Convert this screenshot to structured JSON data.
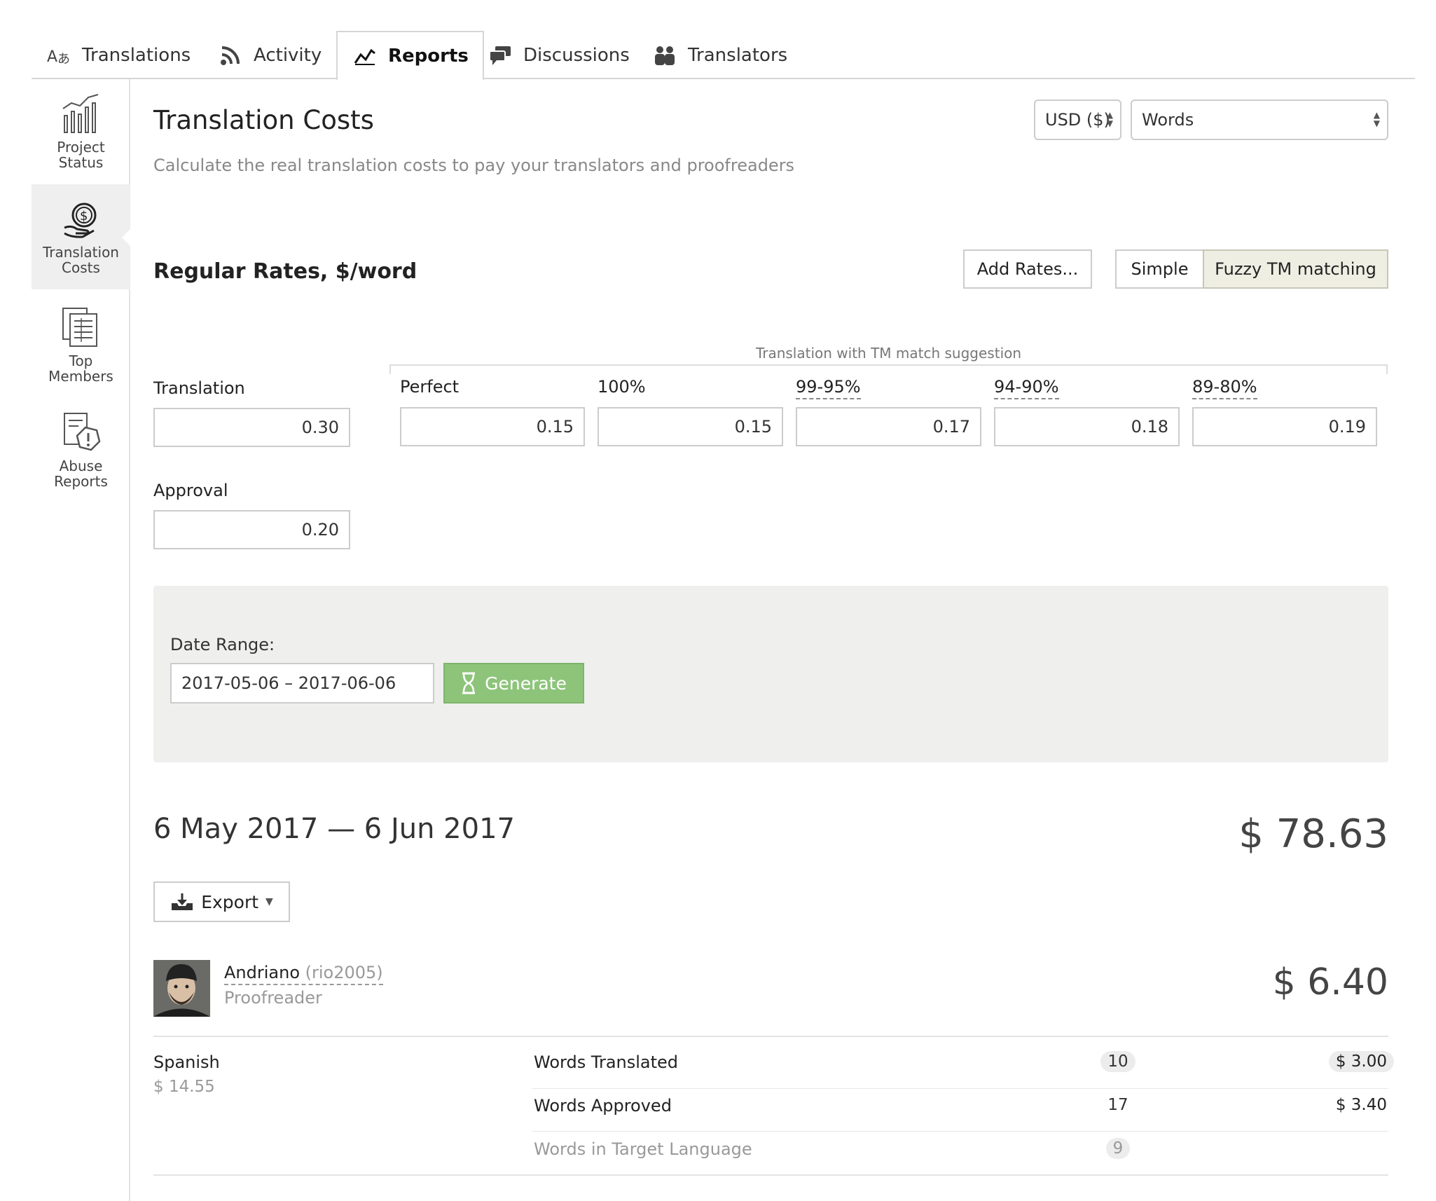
{
  "tabs": [
    {
      "label": "Translations",
      "icon": "translate-icon"
    },
    {
      "label": "Activity",
      "icon": "rss-icon"
    },
    {
      "label": "Reports",
      "icon": "chart-line-icon",
      "active": true
    },
    {
      "label": "Discussions",
      "icon": "chat-bubbles-icon"
    },
    {
      "label": "Translators",
      "icon": "people-icon"
    }
  ],
  "sidebar": {
    "items": [
      {
        "line1": "Project",
        "line2": "Status",
        "icon": "bar-chart-icon"
      },
      {
        "line1": "Translation",
        "line2": "Costs",
        "icon": "money-hand-icon",
        "active": true
      },
      {
        "line1": "Top",
        "line2": "Members",
        "icon": "documents-icon"
      },
      {
        "line1": "Abuse",
        "line2": "Reports",
        "icon": "warning-document-icon"
      }
    ]
  },
  "header": {
    "title": "Translation Costs",
    "subtitle": "Calculate the real translation costs to pay your translators and proofreaders",
    "currency": "USD ($)",
    "unit": "Words"
  },
  "rates": {
    "title": "Regular Rates, $/word",
    "add_rates": "Add Rates...",
    "mode_simple": "Simple",
    "mode_fuzzy": "Fuzzy TM matching",
    "tm_caption": "Translation with TM match suggestion",
    "translation_label": "Translation",
    "translation_value": "0.30",
    "approval_label": "Approval",
    "approval_value": "0.20",
    "tm": [
      {
        "label": "Perfect",
        "value": "0.15"
      },
      {
        "label": "100%",
        "value": "0.15"
      },
      {
        "label": "99-95%",
        "value": "0.17"
      },
      {
        "label": "94-90%",
        "value": "0.18"
      },
      {
        "label": "89-80%",
        "value": "0.19"
      }
    ]
  },
  "date_range": {
    "label": "Date Range:",
    "value": "2017-05-06 – 2017-06-06",
    "generate": "Generate"
  },
  "results": {
    "range_title": "6 May 2017 — 6 Jun 2017",
    "total": "$ 78.63",
    "export": "Export",
    "member": {
      "name": "Andriano",
      "handle": "(rio2005)",
      "role": "Proofreader",
      "total": "$ 6.40"
    },
    "language": {
      "name": "Spanish",
      "total": "$ 14.55"
    },
    "rows": [
      {
        "label": "Words Translated",
        "count": "10",
        "amount": "$ 3.00"
      },
      {
        "label": "Words Approved",
        "count": "17",
        "amount": "$ 3.40"
      },
      {
        "label": "Words in Target Language",
        "count": "9",
        "amount": ""
      }
    ]
  },
  "colors": {
    "accent_green": "#8dc47a",
    "pressed_button": "#efeee3",
    "panel_bg": "#efefed"
  }
}
